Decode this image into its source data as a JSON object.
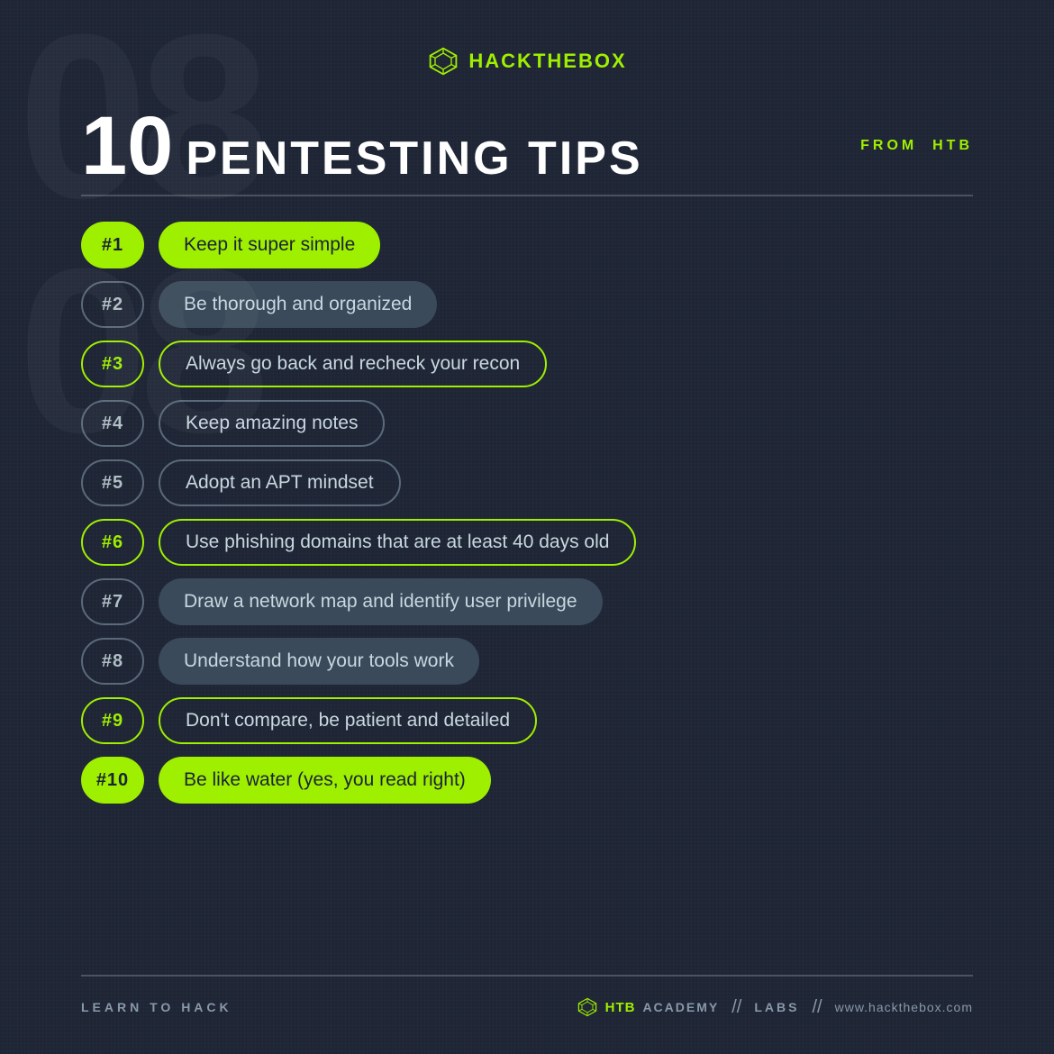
{
  "logo": {
    "text_hack": "HACK",
    "text_the": "THE",
    "text_box": "BOX"
  },
  "header": {
    "title_number": "10",
    "title_text": "PENTESTING TIPS",
    "from_label": "FROM",
    "from_highlight": "HTB"
  },
  "tips": [
    {
      "number": "#1",
      "text": "Keep it super simple",
      "number_style": "solid-green",
      "text_style": "solid-green"
    },
    {
      "number": "#2",
      "text": "Be thorough and organized",
      "number_style": "outline-gray",
      "text_style": "solid-dark"
    },
    {
      "number": "#3",
      "text": "Always go back and recheck your recon",
      "number_style": "outline-green",
      "text_style": "outline-green"
    },
    {
      "number": "#4",
      "text": "Keep amazing notes",
      "number_style": "outline-gray",
      "text_style": "outline-gray"
    },
    {
      "number": "#5",
      "text": "Adopt an APT mindset",
      "number_style": "outline-gray",
      "text_style": "outline-gray"
    },
    {
      "number": "#6",
      "text": "Use phishing domains that are at least 40 days old",
      "number_style": "outline-green",
      "text_style": "outline-green"
    },
    {
      "number": "#7",
      "text": "Draw a network map and identify user privilege",
      "number_style": "outline-gray",
      "text_style": "solid-dark"
    },
    {
      "number": "#8",
      "text": "Understand how your tools work",
      "number_style": "outline-gray",
      "text_style": "solid-dark"
    },
    {
      "number": "#9",
      "text": "Don't compare, be patient and detailed",
      "number_style": "outline-green",
      "text_style": "outline-green"
    },
    {
      "number": "#10",
      "text": "Be like water (yes, you read right)",
      "number_style": "solid-green",
      "text_style": "solid-green"
    }
  ],
  "footer": {
    "learn_label": "LEARN TO HACK",
    "htb_label": "HTB",
    "academy_label": "ACADEMY",
    "slash1": "//",
    "labs_label": "LABS",
    "slash2": "//",
    "url": "www.hackthebox.com"
  }
}
